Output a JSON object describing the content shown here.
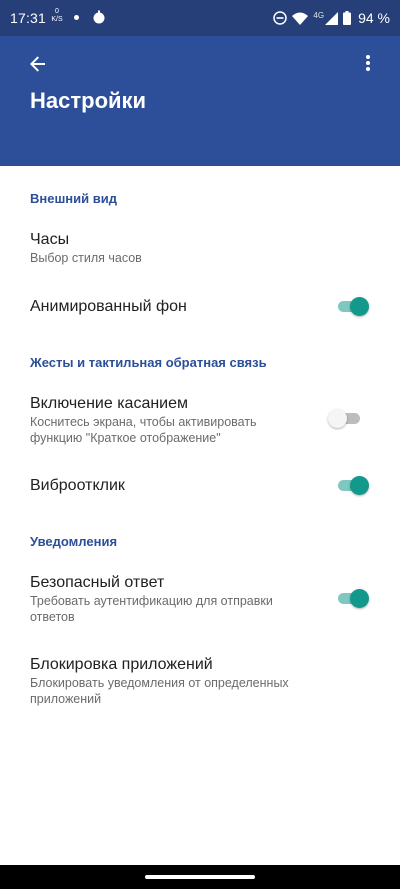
{
  "status_bar": {
    "time": "17:31",
    "net_speed_value": "0",
    "net_speed_unit": "K/S",
    "network_type": "4G",
    "battery": "94 %",
    "icons": [
      "notification-dot",
      "app-notification-icon",
      "do-not-disturb-icon",
      "wifi-icon",
      "cell-signal-icon",
      "battery-icon"
    ]
  },
  "app_bar": {
    "title": "Настройки",
    "back_icon": "arrow-back-icon",
    "menu_icon": "more-vert-icon",
    "color": "#2d4f99"
  },
  "sections": [
    {
      "header": "Внешний вид",
      "items": [
        {
          "title": "Часы",
          "summary": "Выбор стиля часов"
        },
        {
          "title": "Анимированный фон",
          "switch_on": true
        }
      ]
    },
    {
      "header": "Жесты и тактильная обратная связь",
      "items": [
        {
          "title": "Включение касанием",
          "summary_line1": "Коснитесь экрана, чтобы активировать",
          "summary_line2": "функцию \"Краткое отображение\"",
          "switch_on": false
        },
        {
          "title": "Виброотклик",
          "switch_on": true
        }
      ]
    },
    {
      "header": "Уведомления",
      "items": [
        {
          "title": "Безопасный ответ",
          "summary_line1": "Требовать аутентификацию для отправки",
          "summary_line2": "ответов",
          "switch_on": true
        },
        {
          "title": "Блокировка приложений",
          "summary_line1": "Блокировать уведомления от определенных",
          "summary_line2": "приложений"
        }
      ]
    }
  ],
  "colors": {
    "accent_teal": "#12998c",
    "section_header": "#2d4f99"
  }
}
